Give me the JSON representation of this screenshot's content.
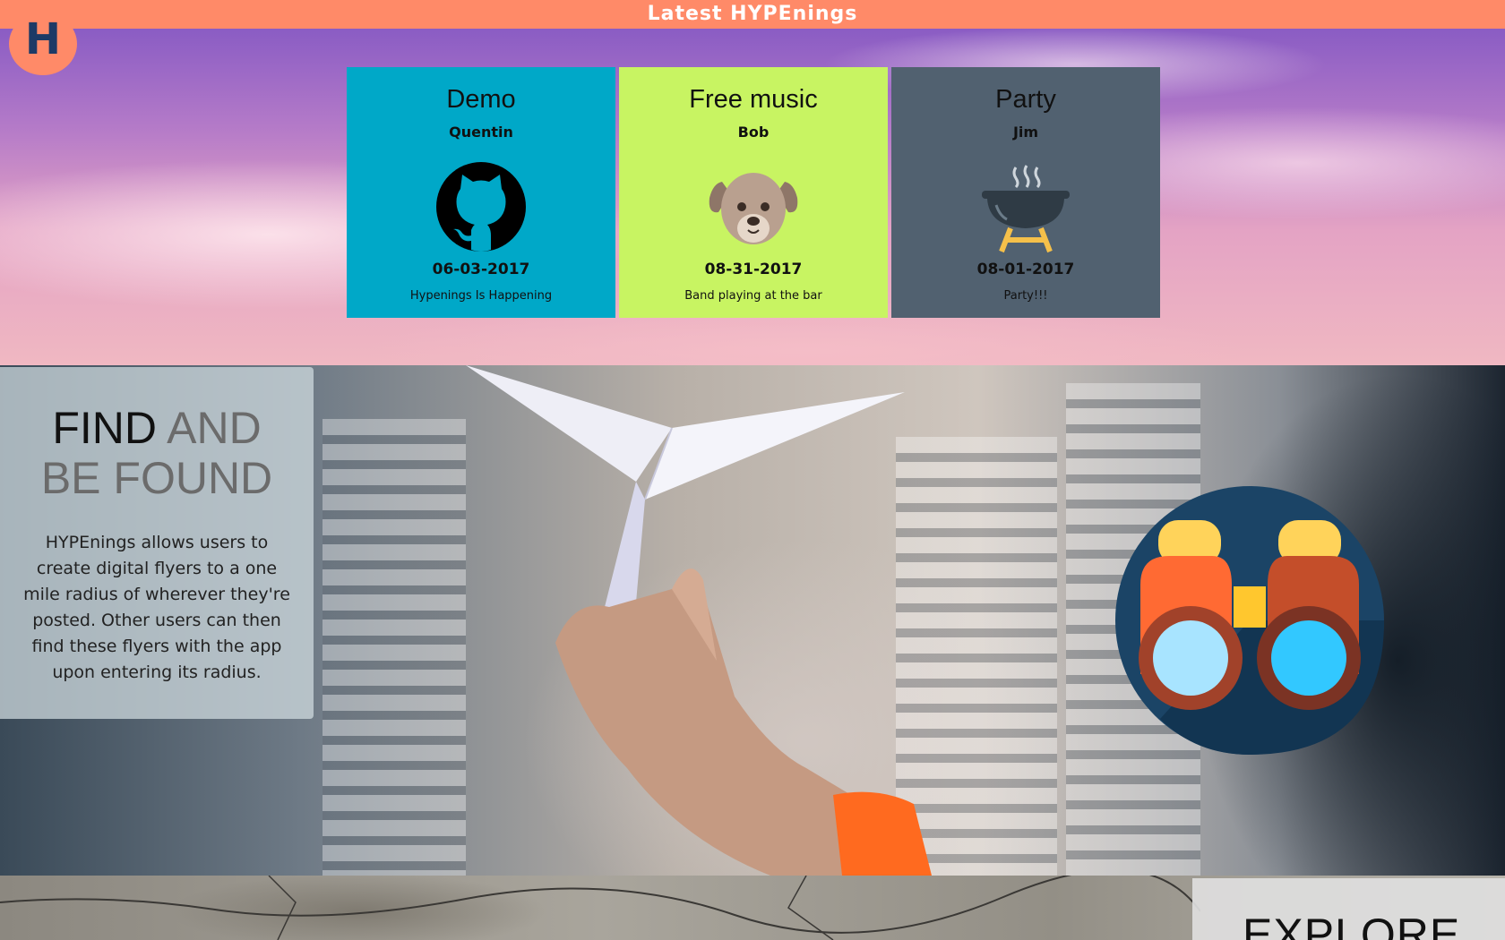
{
  "header": {
    "title": "Latest HYPEnings",
    "logo_letter": "H"
  },
  "cards": [
    {
      "title": "Demo",
      "author": "Quentin",
      "date": "06-03-2017",
      "description": "Hypenings Is Happening",
      "color": "#00a8c8",
      "icon": "github-icon"
    },
    {
      "title": "Free music",
      "author": "Bob",
      "date": "08-31-2017",
      "description": "Band playing at the bar",
      "color": "#c8f462",
      "icon": "dog-icon"
    },
    {
      "title": "Party",
      "author": "Jim",
      "date": "08-01-2017",
      "description": "Party!!!",
      "color": "#516170",
      "icon": "grill-icon"
    }
  ],
  "find": {
    "title_word1": "FIND",
    "title_word2": "AND",
    "title_line2": "BE FOUND",
    "text": "HYPEnings allows users to create digital flyers to a one mile radius of wherever they're posted. Other users can then find these flyers with the app upon entering its radius.",
    "icon": "binoculars-icon"
  },
  "explore": {
    "title": "EXPLORE"
  },
  "colors": {
    "accent": "#ff8a68",
    "logo_text": "#1d3a66"
  }
}
